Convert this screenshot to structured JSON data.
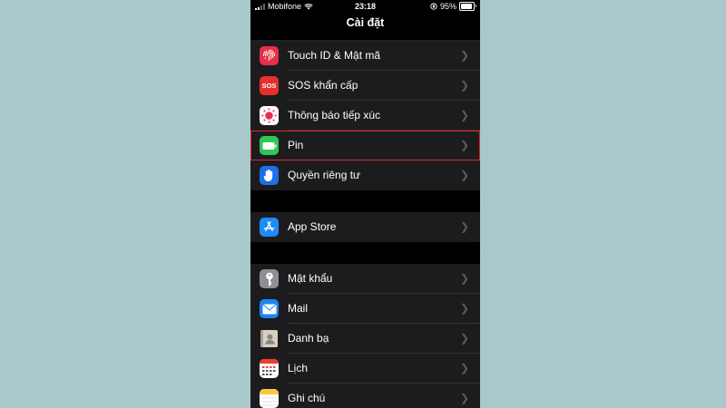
{
  "status_bar": {
    "carrier": "Mobifone",
    "time": "23:18",
    "battery_text": "95%",
    "battery_level": 0.95
  },
  "nav": {
    "title": "Cài đặt"
  },
  "colors": {
    "touch_id": "#e5304a",
    "sos": "#e5302d",
    "exposure": "#e8304c",
    "battery": "#31c658",
    "privacy": "#1d6fe8",
    "app_store": "#1d8bf5",
    "passwords": "#8e8e93",
    "mail": "#1e85f0",
    "contacts": "#bdb6a8",
    "calendar": "#ffffff",
    "notes": "#ffffff",
    "highlight": "#e0282e"
  },
  "groups": [
    {
      "items": [
        {
          "label": "Touch ID & Mật mã",
          "icon": "fingerprint-icon"
        },
        {
          "label": "SOS khẩn cấp",
          "icon": "sos-icon",
          "icon_text": "SOS"
        },
        {
          "label": "Thông báo tiếp xúc",
          "icon": "exposure-notification-icon"
        },
        {
          "label": "Pin",
          "icon": "battery-icon",
          "highlighted": true
        },
        {
          "label": "Quyền riêng tư",
          "icon": "hand-icon"
        }
      ]
    },
    {
      "items": [
        {
          "label": "App Store",
          "icon": "app-store-icon"
        }
      ]
    },
    {
      "items": [
        {
          "label": "Mật khẩu",
          "icon": "key-icon"
        },
        {
          "label": "Mail",
          "icon": "mail-icon"
        },
        {
          "label": "Danh bạ",
          "icon": "contacts-icon"
        },
        {
          "label": "Lịch",
          "icon": "calendar-icon"
        },
        {
          "label": "Ghi chú",
          "icon": "notes-icon"
        }
      ]
    }
  ]
}
